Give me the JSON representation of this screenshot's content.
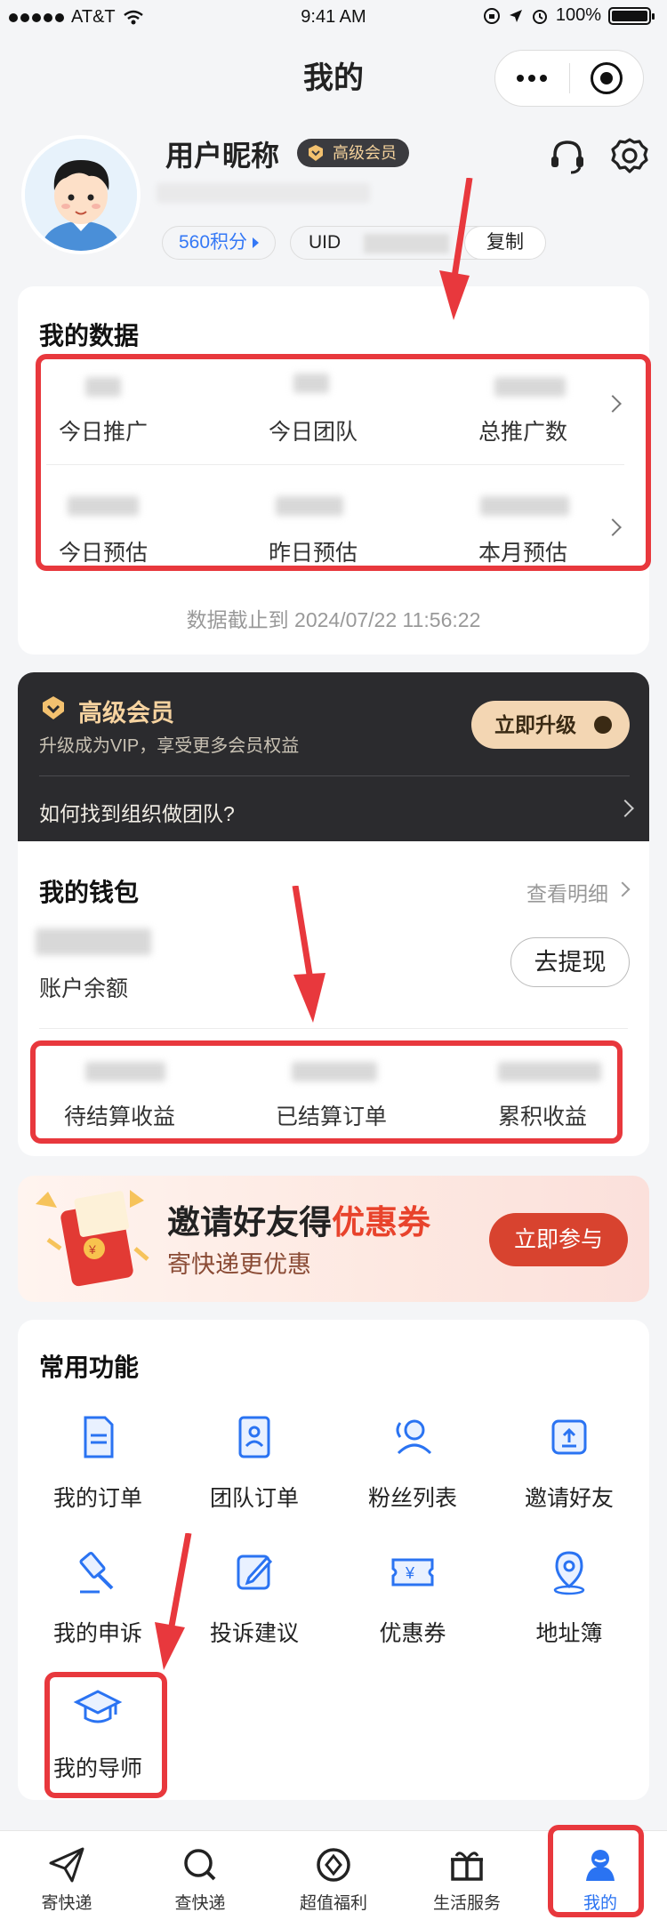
{
  "status_bar": {
    "carrier": "AT&T",
    "time": "9:41 AM",
    "battery": "100%"
  },
  "nav": {
    "title": "我的"
  },
  "profile": {
    "nickname": "用户昵称",
    "vip_badge": "高级会员",
    "points_label": "560积分",
    "uid_label": "UID",
    "copy_label": "复制"
  },
  "my_data": {
    "title": "我的数据",
    "row1": [
      "今日推广",
      "今日团队",
      "总推广数"
    ],
    "row2": [
      "今日预估",
      "昨日预估",
      "本月预估"
    ],
    "as_of": "数据截止到 2024/07/22  11:56:22"
  },
  "vip_card": {
    "title": "高级会员",
    "subtitle": "升级成为VIP，享受更多会员权益",
    "upgrade_label": "立即升级",
    "link": "如何找到组织做团队?"
  },
  "wallet": {
    "title": "我的钱包",
    "view_detail": "查看明细",
    "balance_label": "账户余额",
    "withdraw_label": "去提现",
    "stats": [
      "待结算收益",
      "已结算订单",
      "累积收益"
    ]
  },
  "invite_banner": {
    "title_main": "邀请好友得",
    "title_highlight": "优惠券",
    "subtitle": "寄快递更优惠",
    "join_label": "立即参与"
  },
  "functions": {
    "title": "常用功能",
    "items": [
      {
        "label": "我的订单",
        "icon": "order-doc-icon"
      },
      {
        "label": "团队订单",
        "icon": "team-order-icon"
      },
      {
        "label": "粉丝列表",
        "icon": "fans-icon"
      },
      {
        "label": "邀请好友",
        "icon": "invite-icon"
      },
      {
        "label": "我的申诉",
        "icon": "gavel-icon"
      },
      {
        "label": "投诉建议",
        "icon": "edit-icon"
      },
      {
        "label": "优惠券",
        "icon": "coupon-icon"
      },
      {
        "label": "地址簿",
        "icon": "location-icon"
      },
      {
        "label": "我的导师",
        "icon": "graduation-cap-icon"
      }
    ]
  },
  "tabbar": {
    "items": [
      {
        "label": "寄快递",
        "icon": "send-icon"
      },
      {
        "label": "查快递",
        "icon": "search-icon"
      },
      {
        "label": "超值福利",
        "icon": "compass-icon"
      },
      {
        "label": "生活服务",
        "icon": "gift-icon"
      },
      {
        "label": "我的",
        "icon": "user-icon"
      }
    ],
    "active_color": "#2a73f2"
  },
  "colors": {
    "accent_blue": "#2a73f2",
    "highlight_red": "#e8383d",
    "vip_gold": "#f3d6b3"
  }
}
